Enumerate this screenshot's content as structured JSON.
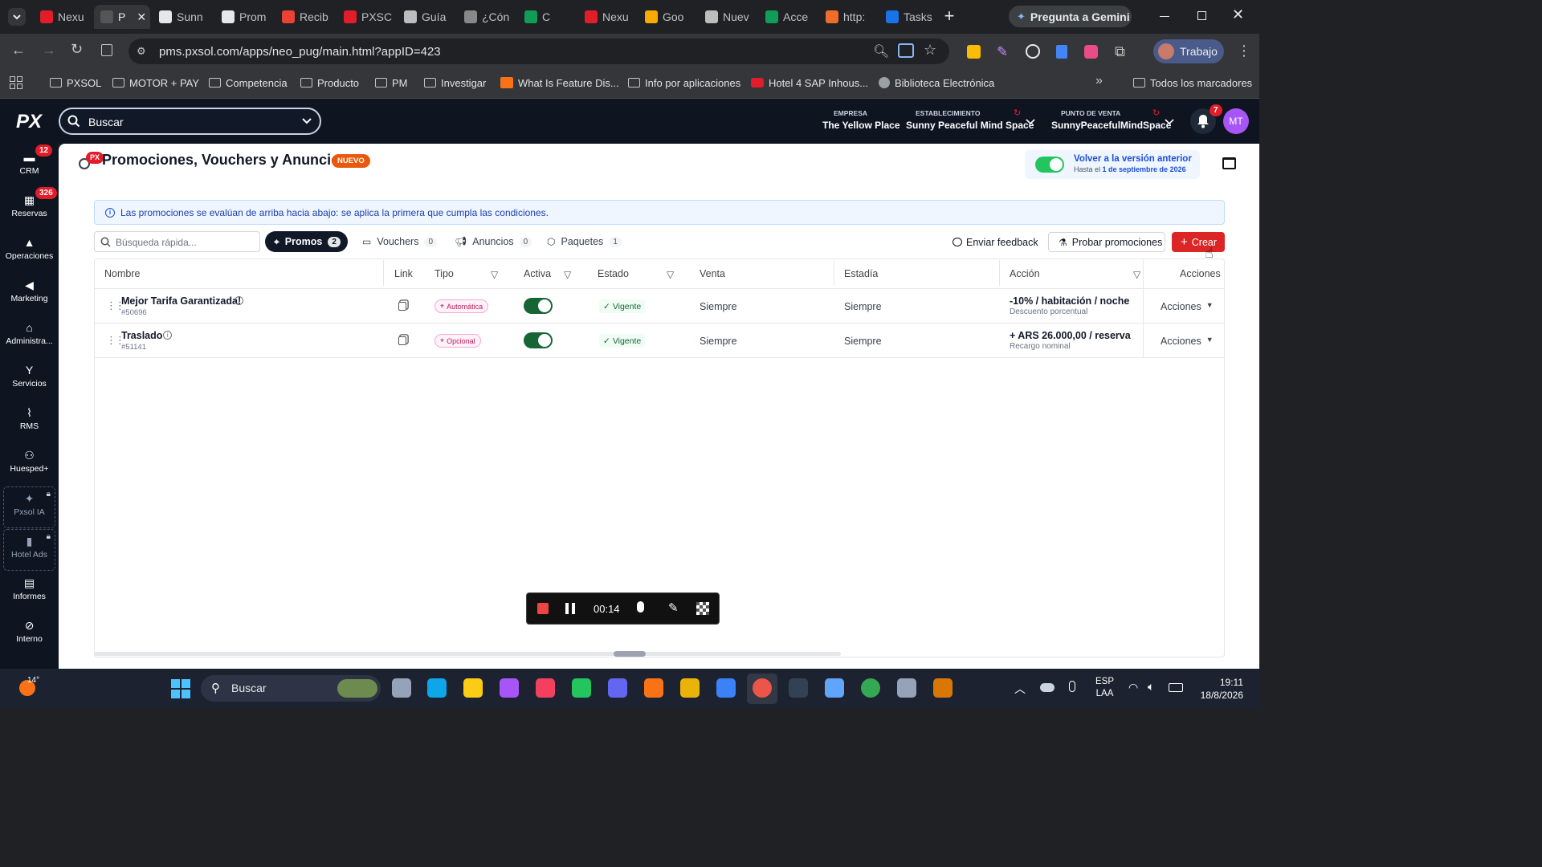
{
  "browser": {
    "tabs": [
      {
        "label": "Nexu",
        "fav": "#e11d2a"
      },
      {
        "label": "P",
        "fav": "#555555"
      },
      {
        "label": "Sunn",
        "fav": "#e5e7eb"
      },
      {
        "label": "Prom",
        "fav": "#e5e7eb"
      },
      {
        "label": "Recib",
        "fav": "#ea4335"
      },
      {
        "label": "PXSC",
        "fav": "#e11d2a"
      },
      {
        "label": "Guía",
        "fav": "#bdbdbd"
      },
      {
        "label": "¿Cón",
        "fav": "#888888"
      },
      {
        "label": "C",
        "fav": "#0f9d58"
      },
      {
        "label": "Nexu",
        "fav": "#e11d2a"
      },
      {
        "label": "Goo",
        "fav": "#f9ab00"
      },
      {
        "label": "Nuev",
        "fav": "#bdbdbd"
      },
      {
        "label": "Acce",
        "fav": "#0f9d58"
      },
      {
        "label": "http:",
        "fav": "#ef6c2a"
      },
      {
        "label": "Tasks",
        "fav": "#1a73e8"
      }
    ],
    "gemini_label": "Pregunta a Gemini",
    "url": "pms.pxsol.com/apps/neo_pug/main.html?appID=423",
    "profile_label": "Trabajo",
    "bookmarks": [
      "PXSOL",
      "MOTOR + PAY",
      "Competencia",
      "Producto",
      "PM",
      "Investigar",
      "What Is Feature Dis...",
      "Info por aplicaciones",
      "Hotel 4 SAP Inhous...",
      "Biblioteca Electrónica"
    ],
    "all_bookmarks": "Todos los marcadores"
  },
  "app": {
    "logo": "PX",
    "search_placeholder": "Buscar",
    "empresa_label": "EMPRESA",
    "empresa_value": "The Yellow Place",
    "establecimiento_label": "ESTABLECIMIENTO",
    "establecimiento_value": "Sunny Peaceful Mind Space",
    "pdv_label": "PUNTO DE VENTA",
    "pdv_value": "SunnyPeacefulMindSpace",
    "notif_count": "7",
    "avatar": "MT"
  },
  "sidebar": [
    {
      "label": "CRM",
      "badge": "12",
      "icon": "chat-icon"
    },
    {
      "label": "Reservas",
      "badge": "326",
      "icon": "calendar-icon"
    },
    {
      "label": "Operaciones",
      "badge": "",
      "icon": "bell-service-icon"
    },
    {
      "label": "Marketing",
      "badge": "",
      "icon": "megaphone-icon"
    },
    {
      "label": "Administra...",
      "badge": "",
      "icon": "bank-icon"
    },
    {
      "label": "Servicios",
      "badge": "",
      "icon": "cocktail-icon"
    },
    {
      "label": "RMS",
      "badge": "",
      "icon": "chart-icon"
    },
    {
      "label": "Huesped+",
      "badge": "",
      "icon": "users-icon"
    },
    {
      "label": "Pxsol IA",
      "badge": "",
      "icon": "sparkle-icon"
    },
    {
      "label": "Hotel Ads",
      "badge": "",
      "icon": "bar-chart-icon"
    },
    {
      "label": "Informes",
      "badge": "",
      "icon": "document-icon"
    },
    {
      "label": "Interno",
      "badge": "",
      "icon": "block-icon"
    }
  ],
  "page": {
    "px_badge": "PX",
    "title": "Promociones, Vouchers y Anuncios",
    "new_badge": "NUEVO",
    "back_version_title": "Volver a la versión anterior",
    "back_version_prefix": "Hasta el ",
    "back_version_date": "1 de septiembre de 2026",
    "info_text": "Las promociones se evalúan de arriba hacia abajo: se aplica la primera que cumpla las condiciones.",
    "quick_search_placeholder": "Búsqueda rápida...",
    "tabs": [
      {
        "label": "Promos",
        "count": "2"
      },
      {
        "label": "Vouchers",
        "count": "0"
      },
      {
        "label": "Anuncios",
        "count": "0"
      },
      {
        "label": "Paquetes",
        "count": "1"
      }
    ],
    "feedback_label": "Enviar feedback",
    "test_label": "Probar promociones",
    "create_label": "Crear",
    "columns": [
      "Nombre",
      "Link",
      "Tipo",
      "Activa",
      "Estado",
      "Venta",
      "Estadía",
      "Acción",
      "Acciones"
    ],
    "rows": [
      {
        "name": "Mejor Tarifa Garantizada!",
        "id": "#50696",
        "tipo": "Automática",
        "activa": true,
        "estado": "Vigente",
        "venta": "Siempre",
        "estadia": "Siempre",
        "accion": "-10% / habitación / noche",
        "accion_sub": "Descuento porcentual",
        "acciones": "Acciones"
      },
      {
        "name": "Traslado",
        "id": "#51141",
        "tipo": "Opcional",
        "activa": true,
        "estado": "Vigente",
        "venta": "Siempre",
        "estadia": "Siempre",
        "accion": "+ ARS 26.000,00 / reserva",
        "accion_sub": "Recargo nominal",
        "acciones": "Acciones"
      }
    ]
  },
  "recorder": {
    "time": "00:14"
  },
  "taskbar": {
    "temperature": "14°",
    "search_placeholder": "Buscar",
    "lang": "ESP",
    "lang_sub": "LAA",
    "time": "19:11",
    "date": "18/8/2026"
  }
}
